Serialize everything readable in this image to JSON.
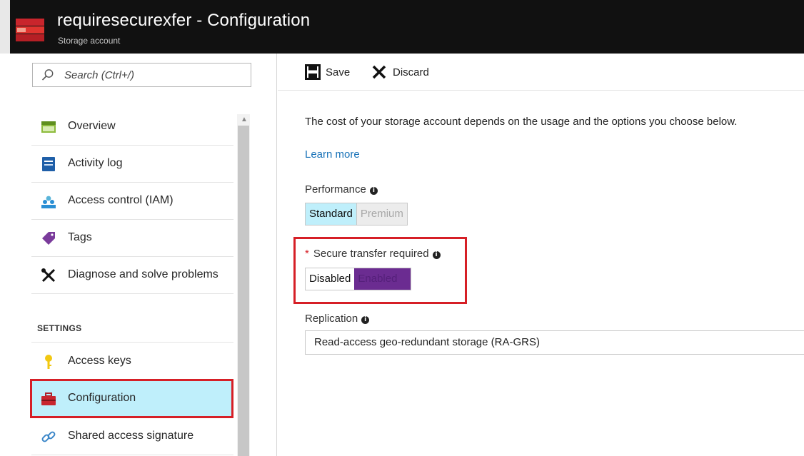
{
  "header": {
    "title": "requiresecurexfer - Configuration",
    "subtitle": "Storage account"
  },
  "sidebar": {
    "search_placeholder": "Search (Ctrl+/)",
    "items": [
      {
        "label": "Overview",
        "icon": "overview-icon"
      },
      {
        "label": "Activity log",
        "icon": "activity-log-icon"
      },
      {
        "label": "Access control (IAM)",
        "icon": "access-control-icon"
      },
      {
        "label": "Tags",
        "icon": "tag-icon"
      },
      {
        "label": "Diagnose and solve problems",
        "icon": "wrench-screwdriver-icon"
      }
    ],
    "section_label": "SETTINGS",
    "settings_items": [
      {
        "label": "Access keys",
        "icon": "key-icon"
      },
      {
        "label": "Configuration",
        "icon": "toolbox-icon",
        "selected": true
      },
      {
        "label": "Shared access signature",
        "icon": "link-icon"
      }
    ]
  },
  "toolbar": {
    "save_label": "Save",
    "discard_label": "Discard"
  },
  "main": {
    "info_text": "The cost of your storage account depends on the usage and the options you choose below.",
    "learn_more": "Learn more",
    "performance": {
      "label": "Performance",
      "options": [
        "Standard",
        "Premium"
      ],
      "selected": "Standard"
    },
    "secure_transfer": {
      "label": "Secure transfer required",
      "required_marker": "*",
      "options": [
        "Disabled",
        "Enabled"
      ],
      "selected": "Enabled"
    },
    "replication": {
      "label": "Replication",
      "value": "Read-access geo-redundant storage (RA-GRS)"
    }
  },
  "colors": {
    "header_bg": "#111111",
    "selected_bg": "#bfeffb",
    "highlight_red": "#d61f26",
    "toggle_enabled": "#6b2c91",
    "link": "#1a73b8"
  }
}
